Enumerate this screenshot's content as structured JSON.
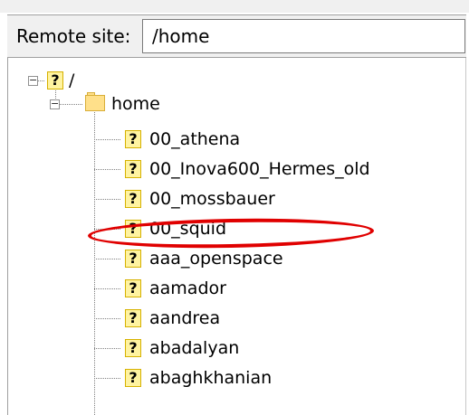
{
  "site_bar": {
    "label": "Remote site:",
    "path_value": "/home"
  },
  "tree": {
    "root": {
      "label": "/",
      "expander": "−",
      "icon": "question-mark-icon"
    },
    "home": {
      "label": "home",
      "expander": "−",
      "icon": "folder-icon"
    },
    "children": [
      {
        "label": "00_athena",
        "icon": "question-mark-icon"
      },
      {
        "label": "00_Inova600_Hermes_old",
        "icon": "question-mark-icon"
      },
      {
        "label": "00_mossbauer",
        "icon": "question-mark-icon"
      },
      {
        "label": "00_squid",
        "icon": "question-mark-icon",
        "highlighted": true
      },
      {
        "label": "aaa_openspace",
        "icon": "question-mark-icon"
      },
      {
        "label": "aamador",
        "icon": "question-mark-icon"
      },
      {
        "label": "aandrea",
        "icon": "question-mark-icon"
      },
      {
        "label": "abadalyan",
        "icon": "question-mark-icon"
      },
      {
        "label": "abaghkhanian",
        "icon": "question-mark-icon"
      }
    ],
    "unknown_glyph": "?"
  },
  "colors": {
    "highlight_ellipse": "#e00000",
    "question_icon_fill": "#fff3a0",
    "folder_fill": "#ffe08a"
  }
}
